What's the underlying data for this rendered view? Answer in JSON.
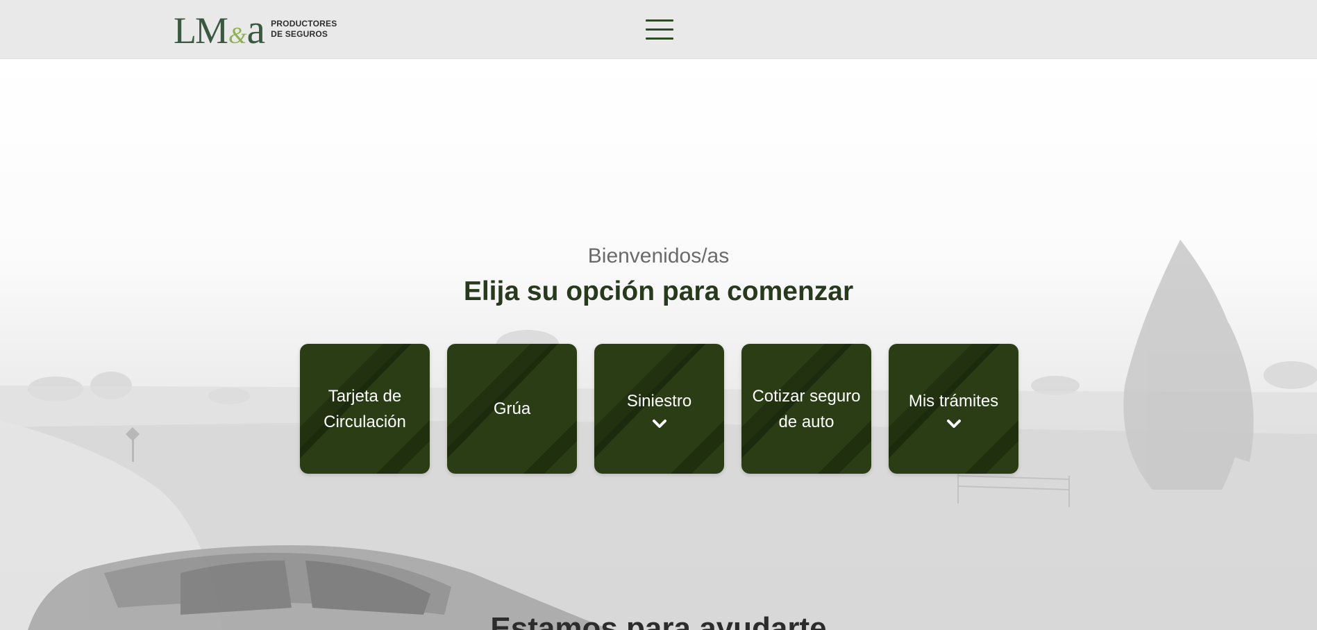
{
  "header": {
    "logo": {
      "mark_left": "LM",
      "mark_amp": "&",
      "mark_right": "a",
      "tag_line1": "PRODUCTORES",
      "tag_line2": "DE SEGUROS"
    },
    "menu_icon": "hamburger-menu-icon"
  },
  "hero": {
    "welcome": "Bienvenidos/as",
    "headline": "Elija su opción para comenzar"
  },
  "cards": [
    {
      "label": "Tarjeta de Circulación",
      "has_chevron": false
    },
    {
      "label": "Grúa",
      "has_chevron": false
    },
    {
      "label": "Siniestro",
      "has_chevron": true
    },
    {
      "label": "Cotizar seguro de auto",
      "has_chevron": false
    },
    {
      "label": "Mis trámites",
      "has_chevron": true
    }
  ],
  "section": {
    "title": "Estamos para ayudarte"
  },
  "colors": {
    "brand_green": "#2a3d14",
    "logo_green": "#3a5a40",
    "logo_accent": "#8fb04e",
    "headline": "#273a1c",
    "header_bg": "#e9e9e9"
  }
}
